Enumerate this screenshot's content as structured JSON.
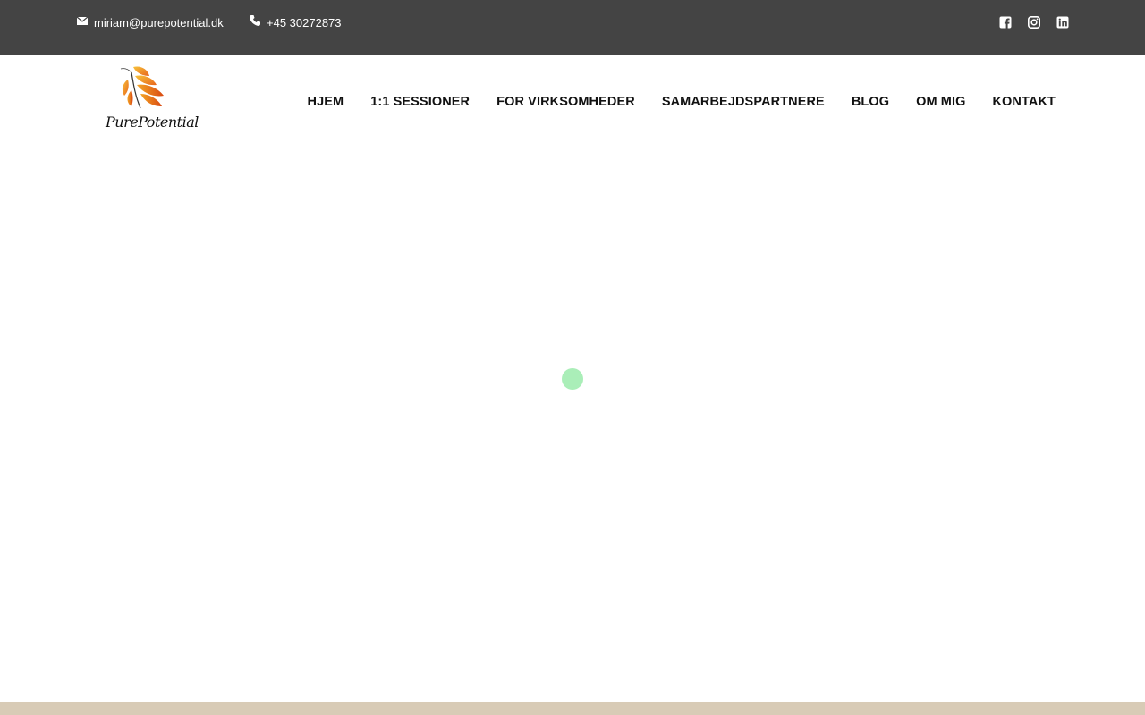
{
  "topbar": {
    "email": "miriam@purepotential.dk",
    "phone": "+45 30272873",
    "email_icon": "envelope-icon",
    "phone_icon": "phone-icon",
    "socials": [
      "facebook-icon",
      "instagram-icon",
      "linkedin-icon"
    ]
  },
  "brand": {
    "logo_text": "PurePotential",
    "logo_icon": "butterfly-icon"
  },
  "nav": {
    "items": [
      {
        "label": "HJEM"
      },
      {
        "label": "1:1 SESSIONER"
      },
      {
        "label": "FOR VIRKSOMHEDER"
      },
      {
        "label": "SAMARBEJDSPARTNERE"
      },
      {
        "label": "BLOG"
      },
      {
        "label": "OM MIG"
      },
      {
        "label": "KONTAKT"
      }
    ]
  },
  "colors": {
    "topbar": "#444444",
    "loader": "#aaeeb8",
    "footer_strip": "#d8cbb6"
  }
}
